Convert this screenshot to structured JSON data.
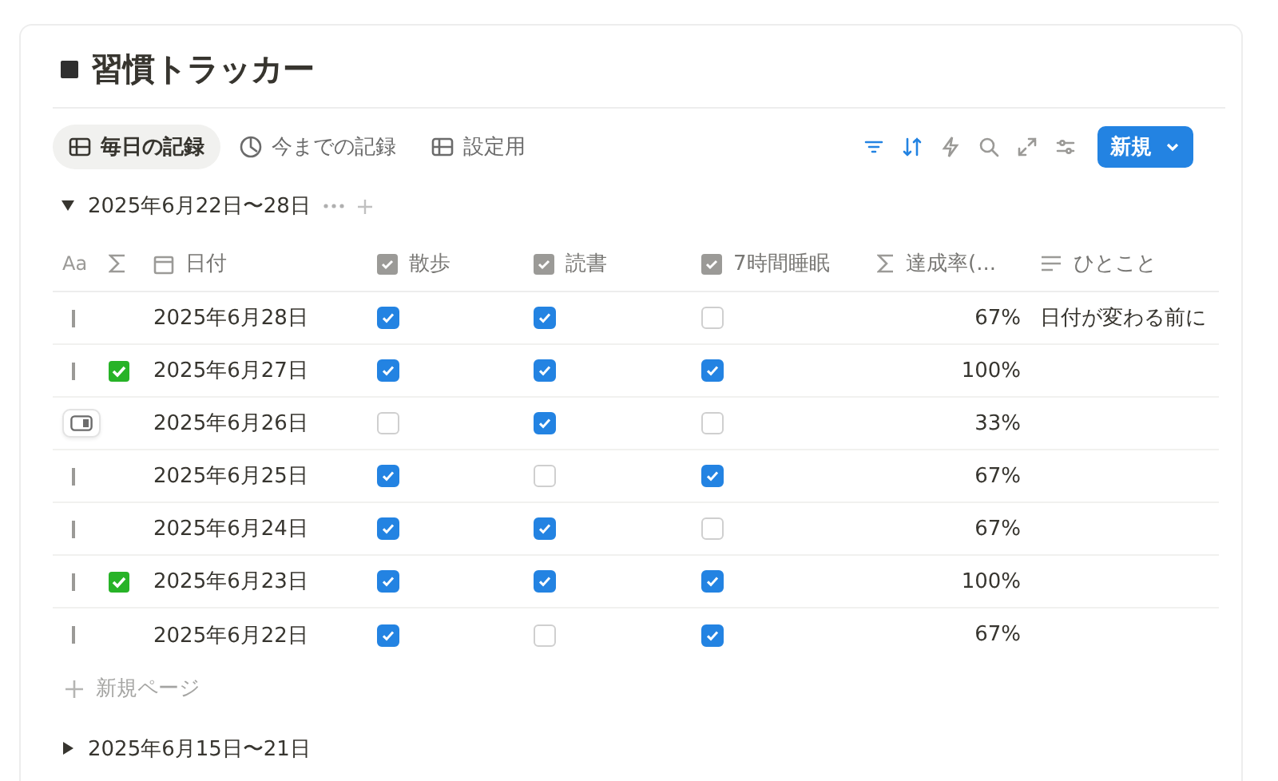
{
  "title": "習慣トラッカー",
  "views": [
    {
      "label": "毎日の記録",
      "kind": "table",
      "selected": true
    },
    {
      "label": "今までの記録",
      "kind": "chart",
      "selected": false
    },
    {
      "label": "設定用",
      "kind": "table",
      "selected": false
    }
  ],
  "toolbar": [
    {
      "kind": "filter",
      "active": true
    },
    {
      "kind": "sort",
      "active": true
    },
    {
      "kind": "automation",
      "active": false
    },
    {
      "kind": "search",
      "active": false
    },
    {
      "kind": "expand",
      "active": false
    },
    {
      "kind": "settings",
      "active": false
    }
  ],
  "new_button": {
    "label": "新規"
  },
  "group": {
    "label": "2025年6月22日〜28日",
    "expanded": true
  },
  "columns": [
    {
      "kind": "title",
      "label": "Aa"
    },
    {
      "kind": "formula"
    },
    {
      "kind": "date",
      "label": "日付"
    },
    {
      "kind": "checkbox",
      "label": "散歩"
    },
    {
      "kind": "checkbox",
      "label": "読書"
    },
    {
      "kind": "checkbox",
      "label": "7時間睡眠"
    },
    {
      "kind": "formula",
      "label": "達成率(..."
    },
    {
      "kind": "text",
      "label": "ひとこと"
    }
  ],
  "rows": [
    {
      "hovered": false,
      "complete": false,
      "date": "2025年6月28日",
      "checks": [
        true,
        true,
        false
      ],
      "rate": "67%",
      "note": "日付が変わる前に"
    },
    {
      "hovered": false,
      "complete": true,
      "date": "2025年6月27日",
      "checks": [
        true,
        true,
        true
      ],
      "rate": "100%"
    },
    {
      "hovered": true,
      "complete": false,
      "date": "2025年6月26日",
      "checks": [
        false,
        true,
        false
      ],
      "rate": "33%"
    },
    {
      "hovered": false,
      "complete": false,
      "date": "2025年6月25日",
      "checks": [
        true,
        false,
        true
      ],
      "rate": "67%"
    },
    {
      "hovered": false,
      "complete": false,
      "date": "2025年6月24日",
      "checks": [
        true,
        true,
        false
      ],
      "rate": "67%"
    },
    {
      "hovered": false,
      "complete": true,
      "date": "2025年6月23日",
      "checks": [
        true,
        true,
        true
      ],
      "rate": "100%"
    },
    {
      "hovered": false,
      "complete": false,
      "date": "2025年6月22日",
      "checks": [
        true,
        false,
        true
      ],
      "rate": "67%"
    }
  ],
  "add_row": {
    "label": "新規ページ"
  },
  "next_group": {
    "label": "2025年6月15日〜21日",
    "expanded": false
  }
}
